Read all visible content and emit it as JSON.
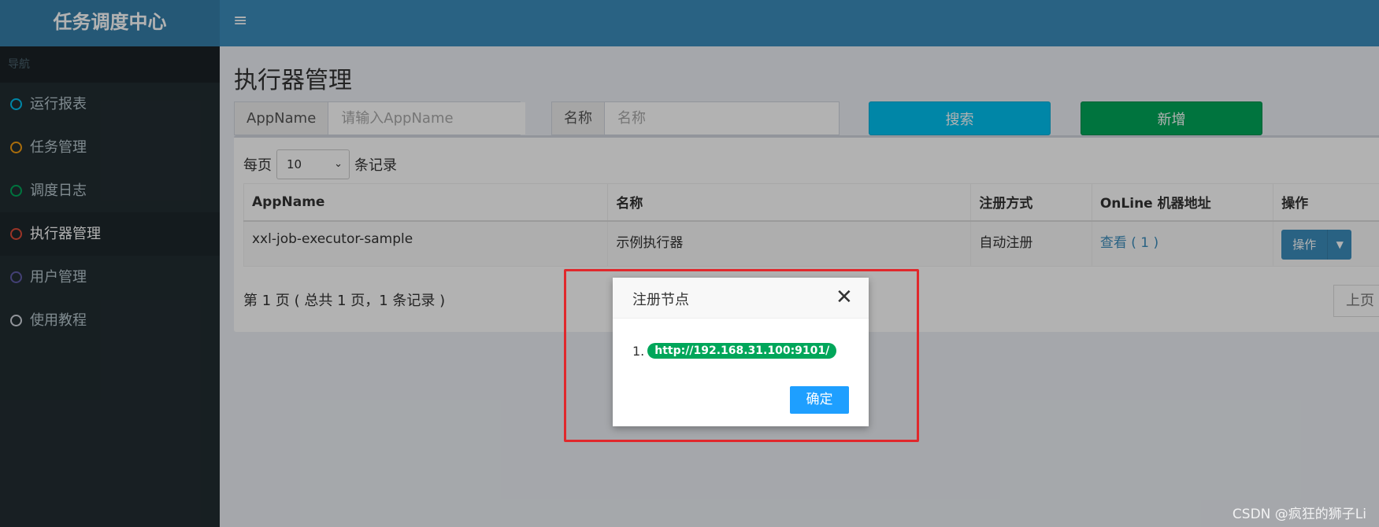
{
  "app": {
    "logo": "任务调度中心"
  },
  "header": {
    "toggle_icon": "≡"
  },
  "sidebar": {
    "nav_header": "导航",
    "items": [
      {
        "label": "运行报表",
        "color": "#00c0ef",
        "active": false
      },
      {
        "label": "任务管理",
        "color": "#f39c12",
        "active": false
      },
      {
        "label": "调度日志",
        "color": "#00a65a",
        "active": false
      },
      {
        "label": "执行器管理",
        "color": "#dd4b39",
        "active": true
      },
      {
        "label": "用户管理",
        "color": "#605ca8",
        "active": false
      },
      {
        "label": "使用教程",
        "color": "#d2d6de",
        "active": false
      }
    ]
  },
  "main": {
    "title": "执行器管理",
    "filters": {
      "appname_label": "AppName",
      "appname_placeholder": "请输入AppName",
      "name_label": "名称",
      "name_placeholder": "名称"
    },
    "search_button": "搜索",
    "add_button": "新增",
    "page_length": {
      "prefix": "每页",
      "value": "10",
      "suffix": "条记录"
    },
    "table": {
      "columns": [
        "AppName",
        "名称",
        "注册方式",
        "OnLine 机器地址",
        "操作"
      ],
      "rows": [
        {
          "appname": "xxl-job-executor-sample",
          "name": "示例执行器",
          "reg_type": "自动注册",
          "online": "查看 ( 1 )",
          "action": "操作"
        }
      ]
    },
    "info": "第 1 页 ( 总共 1 页，1 条记录 )",
    "prev_button": "上页"
  },
  "modal": {
    "title": "注册节点",
    "close_icon": "✕",
    "item_index": "1.",
    "address": "http://192.168.31.100:9101/",
    "ok_button": "确定"
  },
  "watermark": "CSDN @疯狂的狮子Li"
}
